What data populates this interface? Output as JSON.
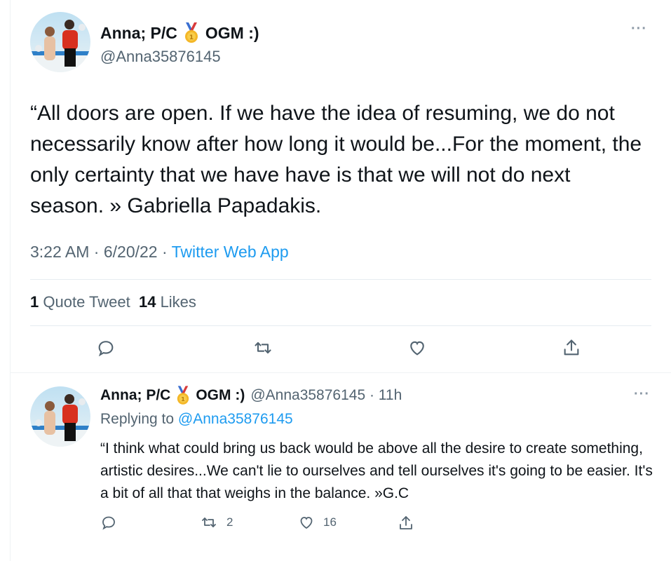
{
  "main_tweet": {
    "display_name": "Anna; P/C",
    "name_suffix": "OGM :)",
    "medal_icon": "gold-medal-icon",
    "handle": "@Anna35876145",
    "more": "···",
    "text": "“All doors are open. If we have the idea of resuming, we do not necessarily know after how long it would be...For the moment, the only certainty that we have have is that we will not do next season. » Gabriella Papadakis.",
    "time": "3:22 AM",
    "sep1": " · ",
    "date": "6/20/22",
    "sep2": " · ",
    "source": "Twitter Web App",
    "quote_count": "1",
    "quote_label": "Quote Tweet",
    "likes_count": "14",
    "likes_label": "Likes"
  },
  "reply_tweet": {
    "display_name": "Anna; P/C",
    "name_suffix": "OGM :)",
    "handle_time": "@Anna35876145 · 11h",
    "more": "···",
    "replying_label": "Replying to",
    "replying_to": "@Anna35876145",
    "text": "“I think what could bring us back would be above all the desire to create something, artistic desires...We can't lie to ourselves and tell ourselves it's going to be easier. It's a bit of all that that weighs in the balance. »G.C",
    "reply_count": "",
    "retweet_count": "2",
    "like_count": "16"
  },
  "colors": {
    "accent": "#1d9bf0",
    "secondary_text": "#536471",
    "primary_text": "#0f1419",
    "divider": "#eff3f4"
  }
}
